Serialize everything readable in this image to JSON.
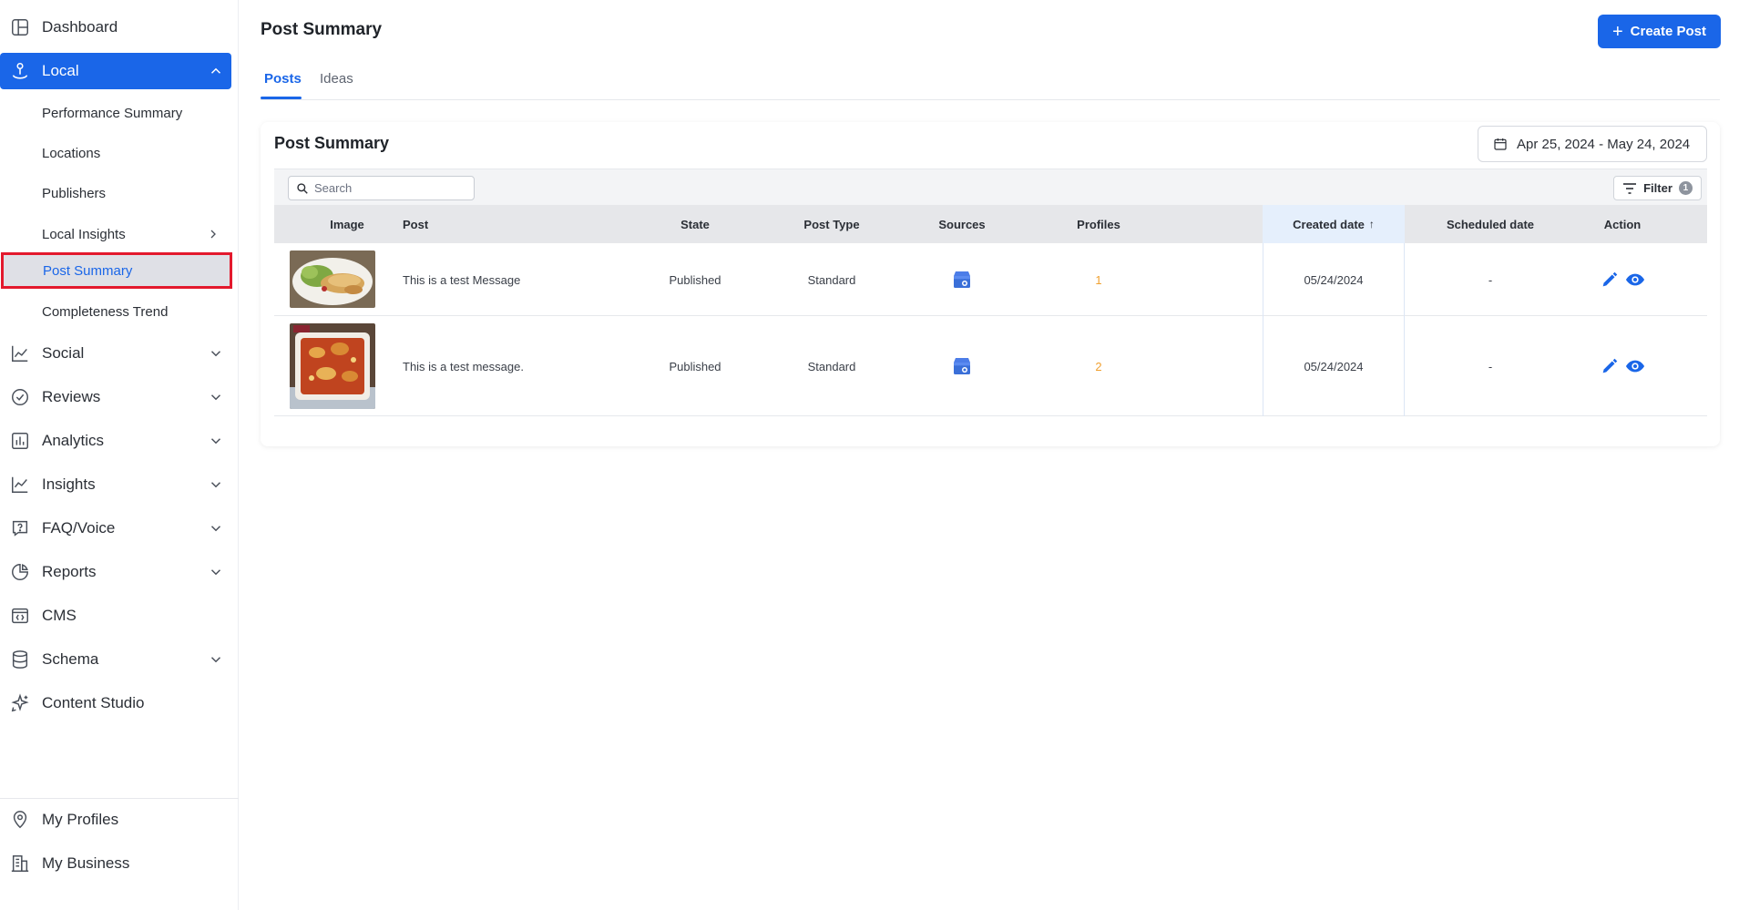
{
  "sidebar": {
    "dashboard": "Dashboard",
    "local": "Local",
    "local_sub": [
      {
        "label": "Performance Summary"
      },
      {
        "label": "Locations"
      },
      {
        "label": "Publishers"
      },
      {
        "label": "Local Insights"
      },
      {
        "label": "Post Summary"
      },
      {
        "label": "Completeness Trend"
      }
    ],
    "items": [
      {
        "label": "Social"
      },
      {
        "label": "Reviews"
      },
      {
        "label": "Analytics"
      },
      {
        "label": "Insights"
      },
      {
        "label": "FAQ/Voice"
      },
      {
        "label": "Reports"
      },
      {
        "label": "CMS"
      },
      {
        "label": "Schema"
      },
      {
        "label": "Content Studio"
      }
    ],
    "bottom": [
      {
        "label": "My Profiles"
      },
      {
        "label": "My Business"
      }
    ]
  },
  "header": {
    "title": "Post Summary",
    "create_button": "Create Post"
  },
  "tabs": [
    {
      "label": "Posts",
      "active": true
    },
    {
      "label": "Ideas",
      "active": false
    }
  ],
  "card": {
    "title": "Post Summary",
    "date_range": "Apr 25, 2024 - May 24, 2024",
    "search_placeholder": "Search",
    "filter_label": "Filter",
    "filter_count": "1"
  },
  "table": {
    "columns": [
      "Image",
      "Post",
      "State",
      "Post Type",
      "Sources",
      "Profiles",
      "Created date",
      "Scheduled date",
      "Action"
    ],
    "sort_arrow": "↑",
    "rows": [
      {
        "image": "food-plate-thumbnail",
        "post": "This is a test Message",
        "state": "Published",
        "post_type": "Standard",
        "source": "google-business-icon",
        "profiles": "1",
        "created": "05/24/2024",
        "scheduled": "-"
      },
      {
        "image": "baked-dish-thumbnail",
        "post": "This is a test message.",
        "state": "Published",
        "post_type": "Standard",
        "source": "google-business-icon",
        "profiles": "2",
        "created": "05/24/2024",
        "scheduled": "-"
      }
    ]
  },
  "colors": {
    "primary": "#1a66e8",
    "highlight_border": "#e3192d",
    "profiles_count": "#f0a030"
  }
}
